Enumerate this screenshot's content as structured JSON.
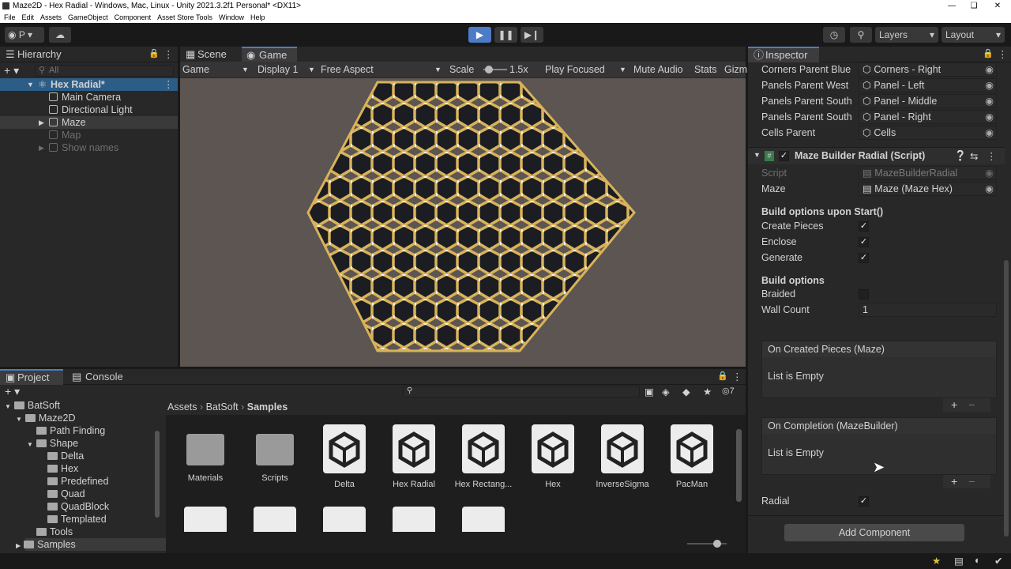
{
  "window": {
    "title": "Maze2D - Hex Radial - Windows, Mac, Linux - Unity 2021.3.2f1 Personal* <DX11>"
  },
  "menu": [
    "File",
    "Edit",
    "Assets",
    "GameObject",
    "Component",
    "Asset Store Tools",
    "Window",
    "Help"
  ],
  "toolbar": {
    "account": "P",
    "layers": "Layers",
    "layout": "Layout"
  },
  "hierarchy": {
    "tab": "Hierarchy",
    "search_placeholder": "All",
    "scene": "Hex Radial*",
    "items": [
      "Main Camera",
      "Directional Light",
      "Maze",
      "Map",
      "Show names"
    ]
  },
  "game": {
    "tabs": [
      "Scene",
      "Game"
    ],
    "display_mode": "Game",
    "display": "Display 1",
    "aspect": "Free Aspect",
    "scale_label": "Scale",
    "scale_value": "1.5x",
    "play_focused": "Play Focused",
    "mute": "Mute Audio",
    "stats": "Stats",
    "gizmos": "Gizm"
  },
  "project": {
    "tabs": [
      "Project",
      "Console"
    ],
    "breadcrumb": [
      "Assets",
      "BatSoft",
      "Samples"
    ],
    "hidden_count": "7",
    "tree": [
      {
        "label": "BatSoft",
        "d": 0
      },
      {
        "label": "Maze2D",
        "d": 1
      },
      {
        "label": "Path Finding",
        "d": 2
      },
      {
        "label": "Shape",
        "d": 2
      },
      {
        "label": "Delta",
        "d": 3
      },
      {
        "label": "Hex",
        "d": 3
      },
      {
        "label": "Predefined",
        "d": 3
      },
      {
        "label": "Quad",
        "d": 3
      },
      {
        "label": "QuadBlock",
        "d": 3
      },
      {
        "label": "Templated",
        "d": 3
      },
      {
        "label": "Tools",
        "d": 2
      },
      {
        "label": "Samples",
        "d": 1
      }
    ],
    "assets": [
      {
        "label": "Materials",
        "kind": "folder"
      },
      {
        "label": "Scripts",
        "kind": "folder"
      },
      {
        "label": "Delta",
        "kind": "unity"
      },
      {
        "label": "Hex Radial",
        "kind": "unity"
      },
      {
        "label": "Hex Rectang...",
        "kind": "unity"
      },
      {
        "label": "Hex",
        "kind": "unity"
      },
      {
        "label": "InverseSigma",
        "kind": "unity"
      },
      {
        "label": "PacMan",
        "kind": "unity"
      }
    ]
  },
  "inspector": {
    "tab": "Inspector",
    "refs": [
      {
        "label": "Corners Parent Blue",
        "value": "Corners - Right"
      },
      {
        "label": "Panels Parent West",
        "value": "Panel - Left"
      },
      {
        "label": "Panels Parent South",
        "value": "Panel - Middle"
      },
      {
        "label": "Panels Parent South",
        "value": "Panel - Right"
      },
      {
        "label": "Cells Parent",
        "value": "Cells"
      }
    ],
    "component": "Maze Builder Radial (Script)",
    "script_label": "Script",
    "script_value": "MazeBuilderRadial",
    "maze_label": "Maze",
    "maze_value": "Maze (Maze Hex)",
    "section1": "Build options upon Start()",
    "create_pieces": "Create Pieces",
    "enclose": "Enclose",
    "generate": "Generate",
    "section2": "Build options",
    "braided": "Braided",
    "wall_count_label": "Wall Count",
    "wall_count": "1",
    "event1": "On Created Pieces (Maze)",
    "event2": "On Completion (MazeBuilder)",
    "empty": "List is Empty",
    "radial": "Radial",
    "add_component": "Add Component"
  }
}
